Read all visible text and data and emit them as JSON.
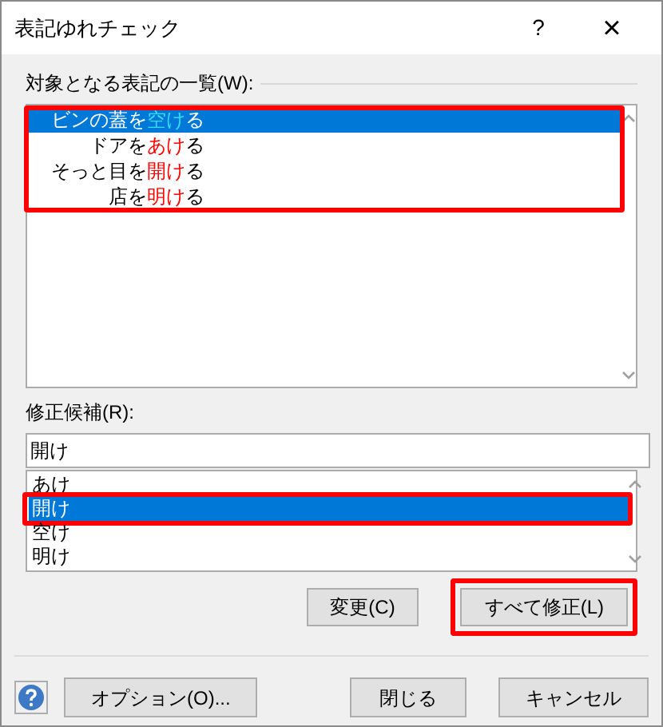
{
  "window": {
    "title": "表記ゆれチェック",
    "help_button": "?",
    "close_button": "×"
  },
  "targets": {
    "label": "対象となる表記の一覧(W):",
    "annotated": true,
    "items": [
      {
        "prefix": "ビンの蓋を",
        "variant": "空け",
        "suffix": "る",
        "selected": true
      },
      {
        "prefix": "ドアを",
        "variant": "あけ",
        "suffix": "る",
        "selected": false
      },
      {
        "prefix": "そっと目を",
        "variant": "開け",
        "suffix": "る",
        "selected": false
      },
      {
        "prefix": "店を",
        "variant": "明け",
        "suffix": "る",
        "selected": false
      }
    ]
  },
  "candidates": {
    "label": "修正候補(R):",
    "value": "開け",
    "items": [
      {
        "text": "あけ",
        "selected": false,
        "annotated": false
      },
      {
        "text": "開け",
        "selected": true,
        "annotated": true
      },
      {
        "text": "空け",
        "selected": false,
        "annotated": false
      },
      {
        "text": "明け",
        "selected": false,
        "annotated": false
      }
    ]
  },
  "actions": [
    {
      "label": "変更(C)",
      "annotated": false
    },
    {
      "label": "すべて修正(L)",
      "annotated": true
    }
  ],
  "footer": {
    "left_buttons": [
      "オプション(O)..."
    ],
    "right_buttons": [
      "閉じる",
      "キャンセル"
    ]
  }
}
